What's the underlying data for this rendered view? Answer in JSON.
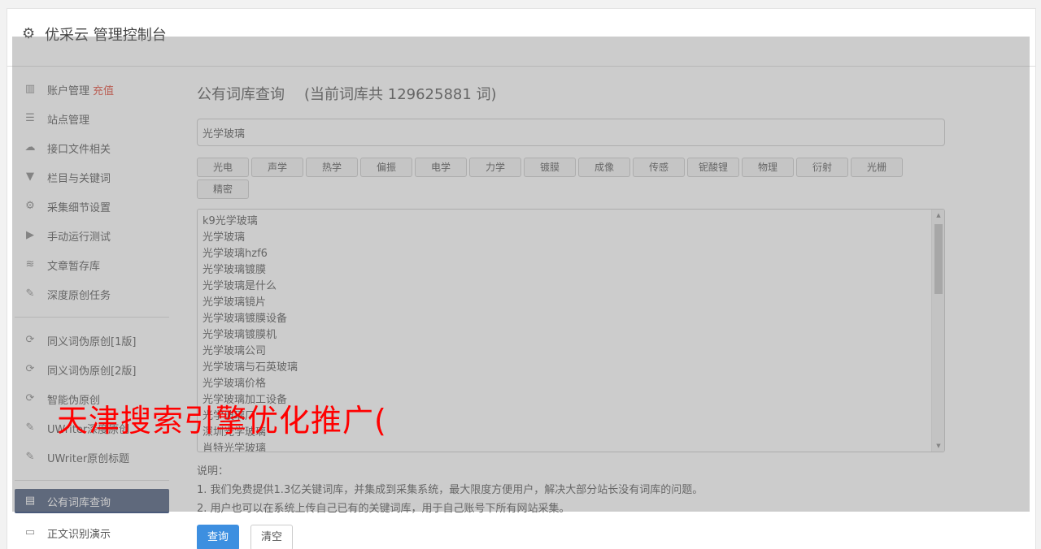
{
  "app": {
    "title": "优采云 管理控制台"
  },
  "sidebar": {
    "items": [
      {
        "label": "账户管理",
        "extra": "充值",
        "icon": "bar-chart-icon"
      },
      {
        "label": "站点管理",
        "icon": "server-icon"
      },
      {
        "label": "接口文件相关",
        "icon": "cloud-upload-icon"
      },
      {
        "label": "栏目与关键词",
        "icon": "filter-icon"
      },
      {
        "label": "采集细节设置",
        "icon": "gears-icon"
      },
      {
        "label": "手动运行测试",
        "icon": "play-icon"
      },
      {
        "label": "文章暂存库",
        "icon": "database-icon"
      },
      {
        "label": "深度原创任务",
        "icon": "edit-icon"
      }
    ],
    "items2": [
      {
        "label": "同义词伪原创[1版]",
        "icon": "refresh-icon"
      },
      {
        "label": "同义词伪原创[2版]",
        "icon": "refresh-icon"
      },
      {
        "label": "智能伪原创",
        "icon": "refresh-icon"
      },
      {
        "label": "UWriter深度原创",
        "icon": "edit-icon"
      },
      {
        "label": "UWriter原创标题",
        "icon": "edit-icon"
      }
    ],
    "items3": [
      {
        "label": "公有词库查询",
        "icon": "book-icon",
        "active": true
      },
      {
        "label": "正文识别演示",
        "icon": "monitor-icon"
      }
    ]
  },
  "main": {
    "title": "公有词库查询",
    "count_text": "(当前词库共 129625881 词)",
    "search_value": "光学玻璃",
    "tags": [
      "光电",
      "声学",
      "热学",
      "偏振",
      "电学",
      "力学",
      "镀膜",
      "成像",
      "传感",
      "铌酸锂",
      "物理",
      "衍射",
      "光栅",
      "精密"
    ],
    "results": [
      "k9光学玻璃",
      "光学玻璃",
      "光学玻璃hzf6",
      "光学玻璃镀膜",
      "光学玻璃是什么",
      "光学玻璃镜片",
      "光学玻璃镀膜设备",
      "光学玻璃镀膜机",
      "光学玻璃公司",
      "光学玻璃与石英玻璃",
      "光学玻璃价格",
      "光学玻璃加工设备",
      "光学玻璃厂",
      "深圳光学玻璃",
      "肖特光学玻璃"
    ],
    "notes": {
      "heading": "说明：",
      "line1": "1. 我们免费提供1.3亿关键词库，并集成到采集系统，最大限度方便用户，解决大部分站长没有词库的问题。",
      "line2": "2. 用户也可以在系统上传自己已有的关键词库，用于自己账号下所有网站采集。"
    },
    "query_button": "查询",
    "clear_button": "清空"
  },
  "watermark": "天津搜索引擎优化推广("
}
